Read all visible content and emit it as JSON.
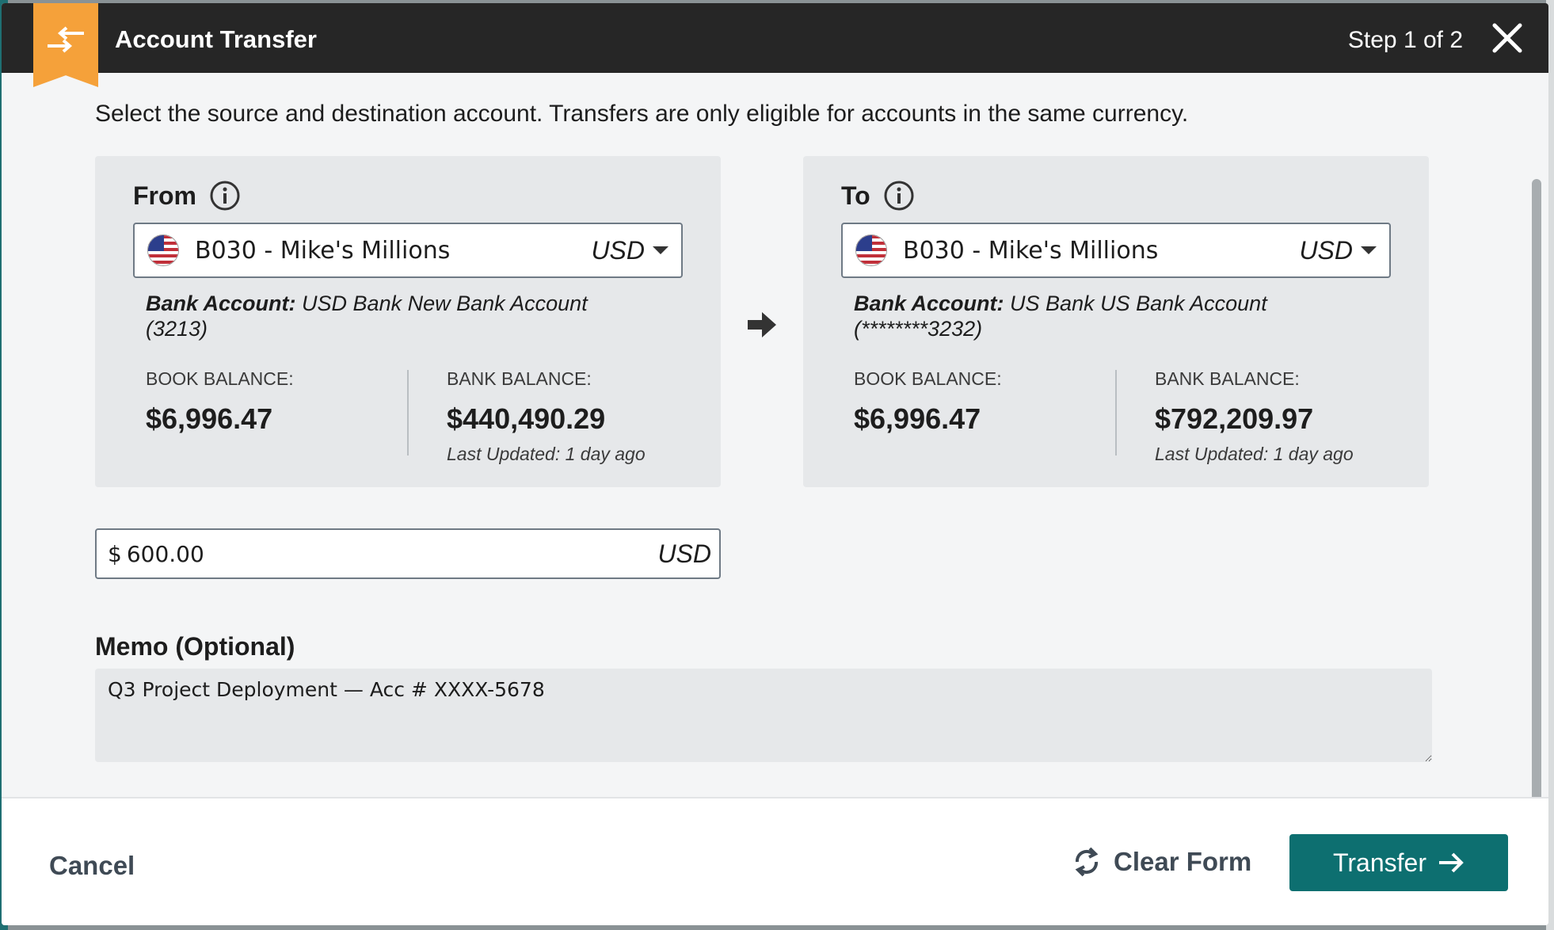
{
  "header": {
    "title": "Account Transfer",
    "step": "Step 1 of 2"
  },
  "intro_text": "Select the source and destination account. Transfers are only eligible for accounts in the same currency.",
  "from": {
    "label": "From",
    "account_name": "B030 - Mike's Millions",
    "currency": "USD",
    "bank_account_label": "Bank Account:",
    "bank_account_value": "USD Bank New Bank Account (3213)",
    "book_balance_label": "BOOK BALANCE:",
    "book_balance": "$6,996.47",
    "bank_balance_label": "BANK BALANCE:",
    "bank_balance": "$440,490.29",
    "last_updated": "Last Updated: 1 day ago"
  },
  "to": {
    "label": "To",
    "account_name": "B030 - Mike's Millions",
    "currency": "USD",
    "bank_account_label": "Bank Account:",
    "bank_account_value": "US Bank US Bank Account (********3232)",
    "book_balance_label": "BOOK BALANCE:",
    "book_balance": "$6,996.47",
    "bank_balance_label": "BANK BALANCE:",
    "bank_balance": "$792,209.97",
    "last_updated": "Last Updated: 1 day ago"
  },
  "amount": {
    "symbol": "$",
    "value": "600.00",
    "currency": "USD"
  },
  "memo": {
    "label": "Memo (Optional)",
    "value": "Q3 Project Deployment — Acc # XXXX-5678"
  },
  "footer": {
    "cancel_label": "Cancel",
    "clear_label": "Clear Form",
    "transfer_label": "Transfer"
  },
  "colors": {
    "header_bg": "#262626",
    "accent_orange": "#f5a13a",
    "primary_teal": "#0d6f70"
  }
}
